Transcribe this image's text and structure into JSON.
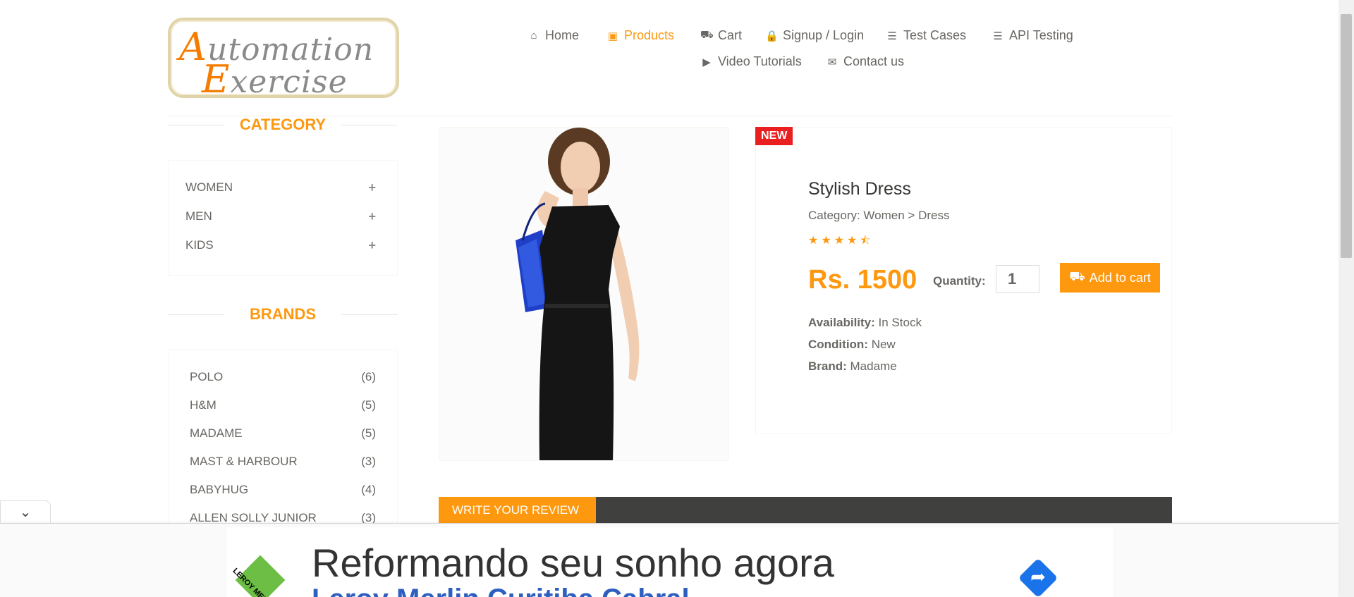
{
  "logo": {
    "line1_cap": "A",
    "line1_rest": "utomation",
    "line2_cap": "E",
    "line2_rest": "xercise"
  },
  "nav": [
    {
      "label": "Home",
      "icon": "home-icon"
    },
    {
      "label": "Products",
      "icon": "briefcase-icon",
      "active": true
    },
    {
      "label": "Cart",
      "icon": "cart-icon"
    },
    {
      "label": "Signup / Login",
      "icon": "lock-icon"
    },
    {
      "label": "Test Cases",
      "icon": "list-icon"
    },
    {
      "label": "API Testing",
      "icon": "list-icon"
    },
    {
      "label": "Video Tutorials",
      "icon": "youtube-icon"
    },
    {
      "label": "Contact us",
      "icon": "envelope-icon"
    }
  ],
  "sidebar": {
    "category_title": "CATEGORY",
    "categories": [
      {
        "label": "WOMEN"
      },
      {
        "label": "MEN"
      },
      {
        "label": "KIDS"
      }
    ],
    "brands_title": "BRANDS",
    "brands": [
      {
        "name": "POLO",
        "count": "(6)"
      },
      {
        "name": "H&M",
        "count": "(5)"
      },
      {
        "name": "MADAME",
        "count": "(5)"
      },
      {
        "name": "MAST & HARBOUR",
        "count": "(3)"
      },
      {
        "name": "BABYHUG",
        "count": "(4)"
      },
      {
        "name": "ALLEN SOLLY JUNIOR",
        "count": "(3)"
      }
    ]
  },
  "product": {
    "badge": "NEW",
    "name": "Stylish Dress",
    "category": "Category: Women > Dress",
    "rating": 4.5,
    "price": "Rs. 1500",
    "quantity_label": "Quantity:",
    "quantity_value": "1",
    "add_to_cart": "Add to cart",
    "availability_label": "Availability:",
    "availability": "In Stock",
    "condition_label": "Condition:",
    "condition": "New",
    "brand_label": "Brand:",
    "brand": "Madame"
  },
  "review": {
    "tab_label": "WRITE YOUR REVIEW"
  },
  "ad": {
    "title": "Reformando seu sonho agora",
    "subtitle": "Leroy Merlin Curitiba Cabral",
    "brand": "LEROY MERLIN"
  },
  "colors": {
    "accent": "#fe980f",
    "badge": "#ea1f1f",
    "review_bar": "#40403e"
  }
}
